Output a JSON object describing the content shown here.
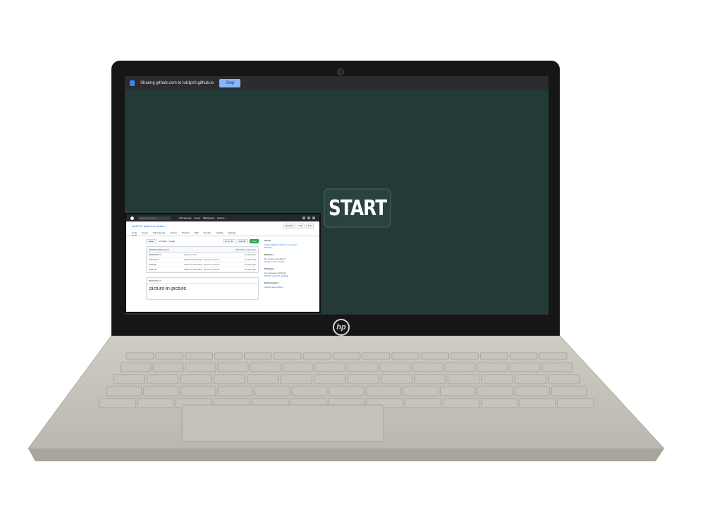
{
  "share_bar": {
    "message": "Sharing github.com to luk1pr0.github.io",
    "stop_label": "Stop"
  },
  "app": {
    "start_label": "START"
  },
  "laptop": {
    "logo": "hp"
  },
  "pip": {
    "header": {
      "search_placeholder": "Search or jump to…",
      "nav": [
        "Pull requests",
        "Issues",
        "Marketplace",
        "Explore"
      ]
    },
    "repo": {
      "title": "luk1Pr0 / picture-in-picture",
      "actions": [
        "Unwatch 1",
        "Star",
        "Fork"
      ],
      "tabs": [
        "Code",
        "Issues",
        "Pull requests",
        "Actions",
        "Projects",
        "Wiki",
        "Security",
        "Insights",
        "Settings"
      ]
    },
    "toolbar": {
      "branch": "master",
      "branches": "1 branch",
      "tags": "0 tags",
      "go_to_file": "Go to file",
      "add_file": "Add file",
      "code": "Code"
    },
    "commit": {
      "message": "luk1Pr0 initial commit",
      "hash": "a8b17a8 21 days ago"
    },
    "files": [
      {
        "name": "README.md",
        "message": "Initial commit",
        "age": "21 days ago"
      },
      {
        "name": "index.html",
        "message": "Added functionality - picture-in-picture",
        "age": "21 days ago"
      },
      {
        "name": "script.js",
        "message": "Added functionality - picture-in-picture",
        "age": "21 days ago"
      },
      {
        "name": "style.css",
        "message": "Added functionality - picture-in-picture",
        "age": "21 days ago"
      }
    ],
    "readme": {
      "filename": "README.md",
      "heading": "picture-in-picture"
    },
    "sidebar": {
      "about_heading": "About",
      "about_link": "luk1pr0.github.io/picture-in-picture/",
      "about_readme": "Readme",
      "releases_heading": "Releases",
      "releases_text": "No releases published",
      "releases_link": "Create a new release",
      "packages_heading": "Packages",
      "packages_text": "No packages published",
      "packages_link": "Publish your first package",
      "env_heading": "Environments",
      "env_item": "github-pages Active"
    }
  },
  "colors": {
    "screen_bg": "#243a38",
    "stop_button": "#8ab4f8",
    "code_button": "#2da44e"
  }
}
